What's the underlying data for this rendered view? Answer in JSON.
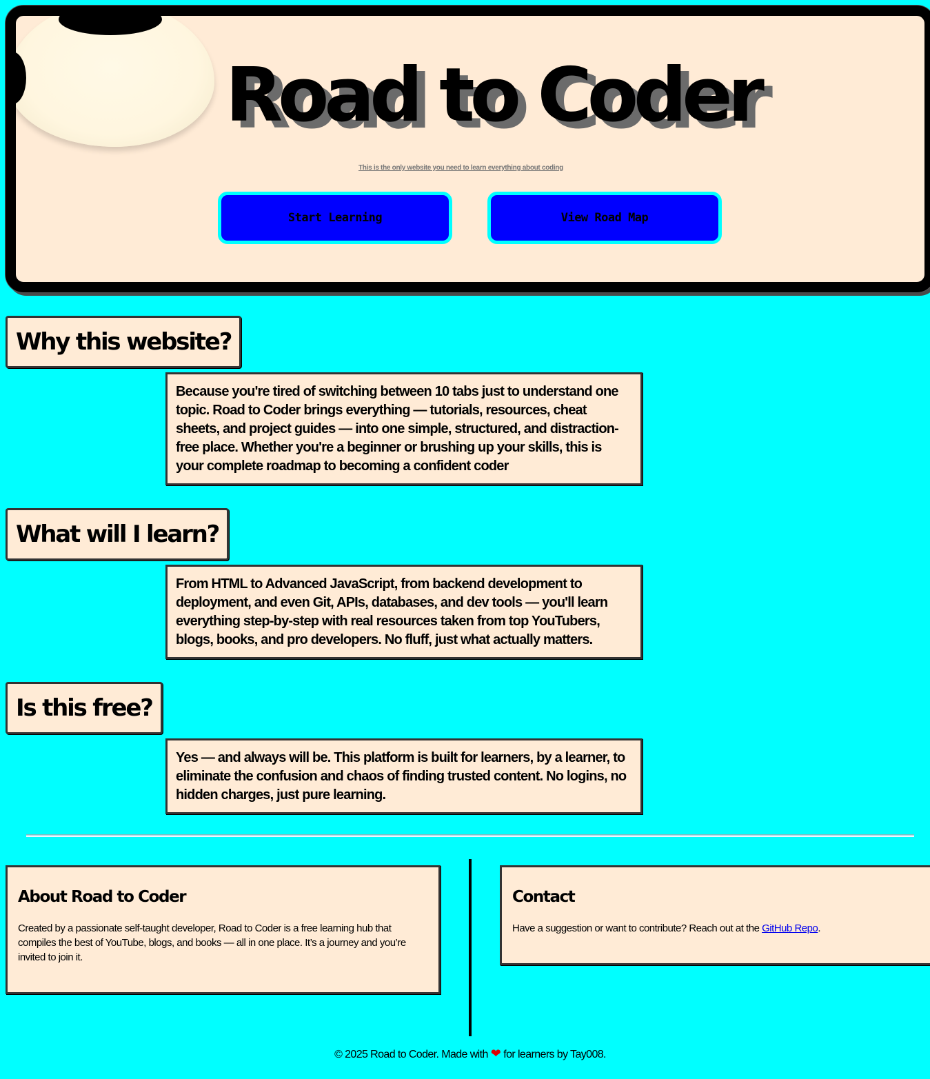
{
  "hero": {
    "title": "Road to Coder",
    "subtitle": "This is the only website you need to learn everything about coding",
    "start_button": "Start Learning",
    "roadmap_button": "View Road Map"
  },
  "faq": [
    {
      "question": "Why this website?",
      "answer": "Because you're tired of switching between 10 tabs just to understand one topic. Road to Coder brings everything — tutorials, resources, cheat sheets, and project guides — into one simple, structured, and distraction-free place. Whether you're a beginner or brushing up your skills, this is your complete roadmap to becoming a confident coder"
    },
    {
      "question": "What will I learn?",
      "answer": "From HTML to Advanced JavaScript, from backend development to deployment, and even Git, APIs, databases, and dev tools — you'll learn everything step-by-step with real resources taken from top YouTubers, blogs, books, and pro developers. No fluff, just what actually matters."
    },
    {
      "question": "Is this free?",
      "answer": "Yes — and always will be. This platform is built for learners, by a learner, to eliminate the confusion and chaos of finding trusted content. No logins, no hidden charges, just pure learning."
    }
  ],
  "footer": {
    "about_title": "About Road to Coder",
    "about_text": "Created by a passionate self-taught developer, Road to Coder is a free learning hub that compiles the best of YouTube, blogs, and books — all in one place. It’s a journey and you’re invited to join it.",
    "contact_title": "Contact",
    "contact_text": "Have a suggestion or want to contribute? Reach out at the",
    "contact_link": "GitHub Repo",
    "contact_end": ".",
    "copyright_before": "© 2025 Road to Coder. Made with",
    "copyright_after": "for learners by Tay008."
  },
  "colors": {
    "background": "#00FFFF",
    "card": "#FFEBD6",
    "button": "#0000FF",
    "heart": "#E00000"
  },
  "icons": {
    "heart": "heart-icon"
  }
}
